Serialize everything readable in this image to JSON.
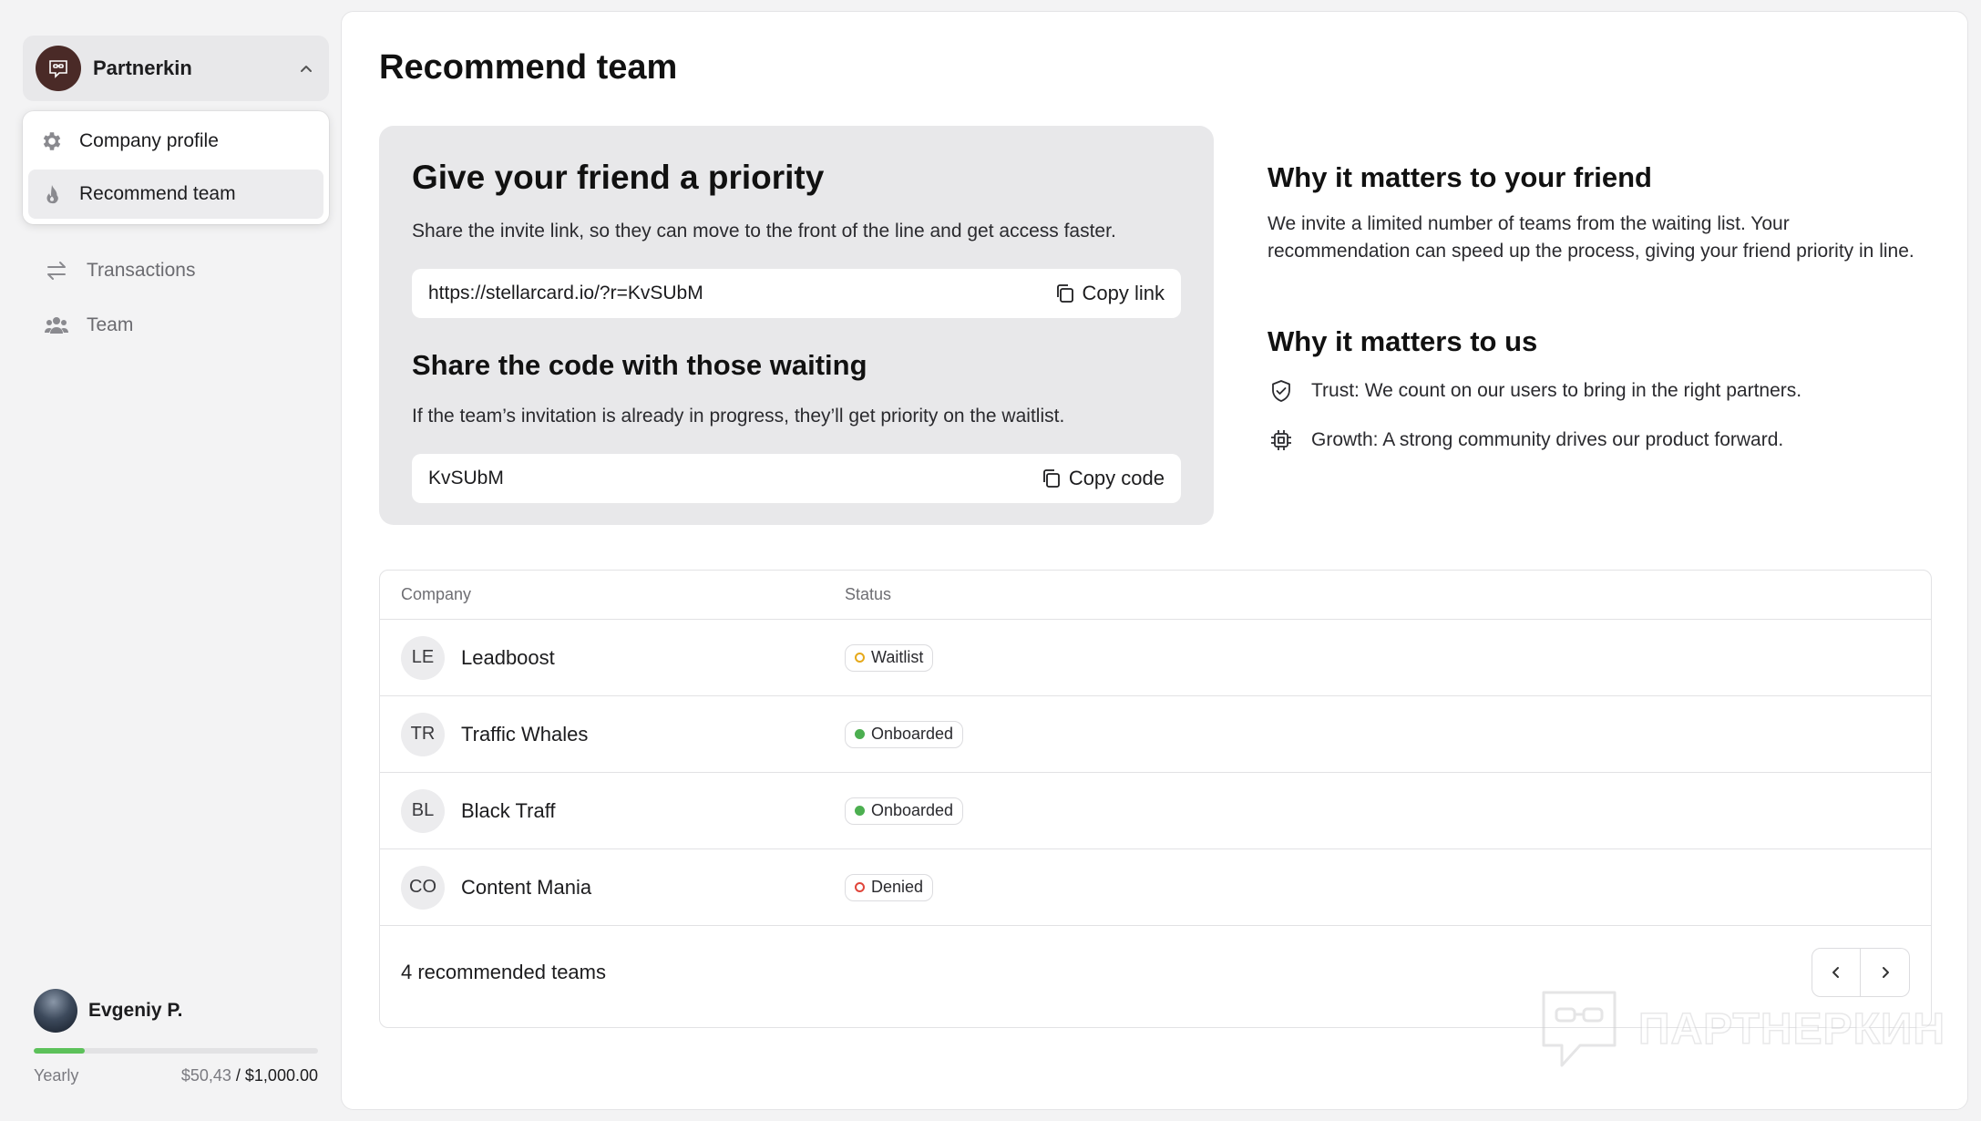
{
  "sidebar": {
    "org_name": "Partnerkin",
    "menu": [
      {
        "label": "Company profile",
        "icon": "gear-icon"
      },
      {
        "label": "Recommend team",
        "icon": "flame-icon"
      }
    ],
    "nav": [
      {
        "label": "Transactions",
        "icon": "arrows-swap-icon"
      },
      {
        "label": "Team",
        "icon": "users-icon"
      }
    ],
    "user": {
      "name": "Evgeniy P.",
      "plan": "Yearly",
      "spent": "$50,43",
      "limit": "/ $1,000.00",
      "progress_pct": 18
    }
  },
  "main": {
    "title": "Recommend team",
    "invite": {
      "heading": "Give your friend a priority",
      "description": "Share the invite link, so they can move to the front of the line and get access faster.",
      "link": "https://stellarcard.io/?r=KvSUbM",
      "copy_link_label": "Copy link",
      "code_heading": "Share the code with those waiting",
      "code_description": "If the team’s invitation is already in progress, they’ll get priority on the waitlist.",
      "code": "KvSUbM",
      "copy_code_label": "Copy code"
    },
    "why_friend": {
      "heading": "Why it matters to your friend",
      "text": "We invite a limited number of teams from the waiting list. Your recommendation can speed up the process, giving your friend priority in line."
    },
    "why_us": {
      "heading": "Why it matters to us",
      "points": [
        {
          "icon": "shield-check-icon",
          "text": "Trust: We count on our users to bring in the right partners."
        },
        {
          "icon": "chip-icon",
          "text": "Growth: A strong community drives our product forward."
        }
      ]
    },
    "table": {
      "columns": [
        "Company",
        "Status"
      ],
      "rows": [
        {
          "initials": "LE",
          "company": "Leadboost",
          "status": "Waitlist",
          "status_color": "#e6a91a",
          "status_style": "ring"
        },
        {
          "initials": "TR",
          "company": "Traffic Whales",
          "status": "Onboarded",
          "status_color": "#4caf50",
          "status_style": "solid"
        },
        {
          "initials": "BL",
          "company": "Black Traff",
          "status": "Onboarded",
          "status_color": "#4caf50",
          "status_style": "solid"
        },
        {
          "initials": "CO",
          "company": "Content Mania",
          "status": "Denied",
          "status_color": "#e0453a",
          "status_style": "ring"
        }
      ],
      "footer": "4 recommended teams"
    },
    "watermark": "ПАРТНЕРКИН"
  }
}
